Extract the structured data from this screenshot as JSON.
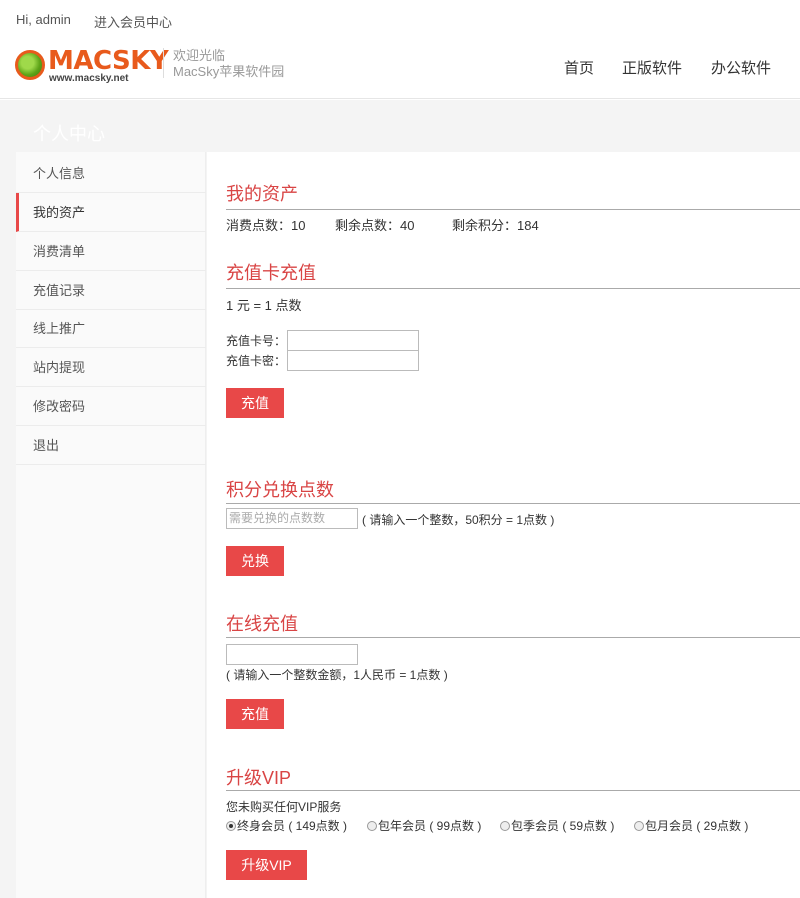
{
  "topbar": {
    "greeting": "Hi, admin",
    "member_center_link": "进入会员中心"
  },
  "header": {
    "logo_text": "MACSKY",
    "logo_url": "www.macsky.net",
    "welcome_line1": "欢迎光临",
    "welcome_line2": "MacSky苹果软件园",
    "nav": [
      "首页",
      "正版软件",
      "办公软件",
      "(partial)"
    ]
  },
  "banner": {
    "title": "个人中心"
  },
  "sidebar": {
    "items": [
      {
        "label": "个人信息"
      },
      {
        "label": "我的资产"
      },
      {
        "label": "消费清单"
      },
      {
        "label": "充值记录"
      },
      {
        "label": "线上推广"
      },
      {
        "label": "站内提现"
      },
      {
        "label": "修改密码"
      },
      {
        "label": "退出"
      }
    ],
    "active_index": 1
  },
  "assets": {
    "title": "我的资产",
    "consumed": "消费点数：10",
    "remaining": "剩余点数：40",
    "credits": "剩余积分：184"
  },
  "card_recharge": {
    "title": "充值卡充值",
    "rate": "1 元 = 1 点数",
    "card_no_label": "充值卡号：",
    "card_pwd_label": "充值卡密：",
    "button": "充值"
  },
  "exchange": {
    "title": "积分兑换点数",
    "placeholder": "需要兑换的点数数",
    "hint": "( 请输入一个整数，50积分 = 1点数 )",
    "button": "兑换"
  },
  "online_recharge": {
    "title": "在线充值",
    "hint": "( 请输入一个整数金额，1人民币 = 1点数 )",
    "button": "充值"
  },
  "vip": {
    "title": "升级VIP",
    "status": "您未购买任何VIP服务",
    "options": [
      {
        "label": "终身会员 ( 149点数 )",
        "checked": true
      },
      {
        "label": "包年会员 ( 99点数 )",
        "checked": false
      },
      {
        "label": "包季会员 ( 59点数 )",
        "checked": false
      },
      {
        "label": "包月会员 ( 29点数 )",
        "checked": false
      }
    ],
    "button": "升级VIP"
  },
  "colors": {
    "accent": "#e84848",
    "title_red": "#d94545",
    "logo_orange": "#e85a1c"
  }
}
